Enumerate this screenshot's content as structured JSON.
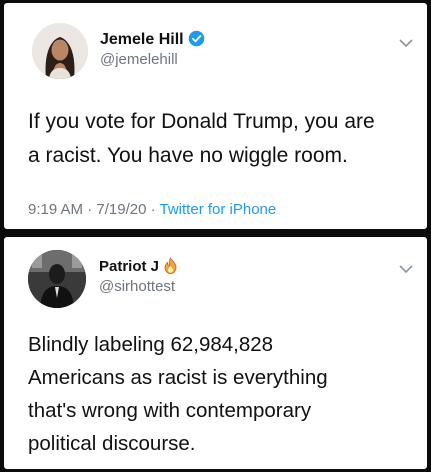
{
  "tweets": [
    {
      "display_name": "Jemele Hill",
      "handle": "@jemelehill",
      "verified": true,
      "text_lines": [
        "If you vote for Donald Trump, you are",
        "a racist. You have no wiggle room."
      ],
      "time": "9:19 AM",
      "date": "7/19/20",
      "source": "Twitter for iPhone",
      "separator": "·"
    },
    {
      "display_name": "Patriot J",
      "handle": "@sirhottest",
      "emoji_icon": "fire-emoji-icon",
      "text_lines": [
        "Blindly labeling 62,984,828",
        "Americans as racist is everything",
        "that's wrong with contemporary",
        "political discourse."
      ]
    }
  ],
  "colors": {
    "background": "#0b0b0b",
    "card": "#ffffff",
    "secondary_text": "#6e767d",
    "link": "#1d9bf0",
    "verified": "#1d9bf0"
  }
}
